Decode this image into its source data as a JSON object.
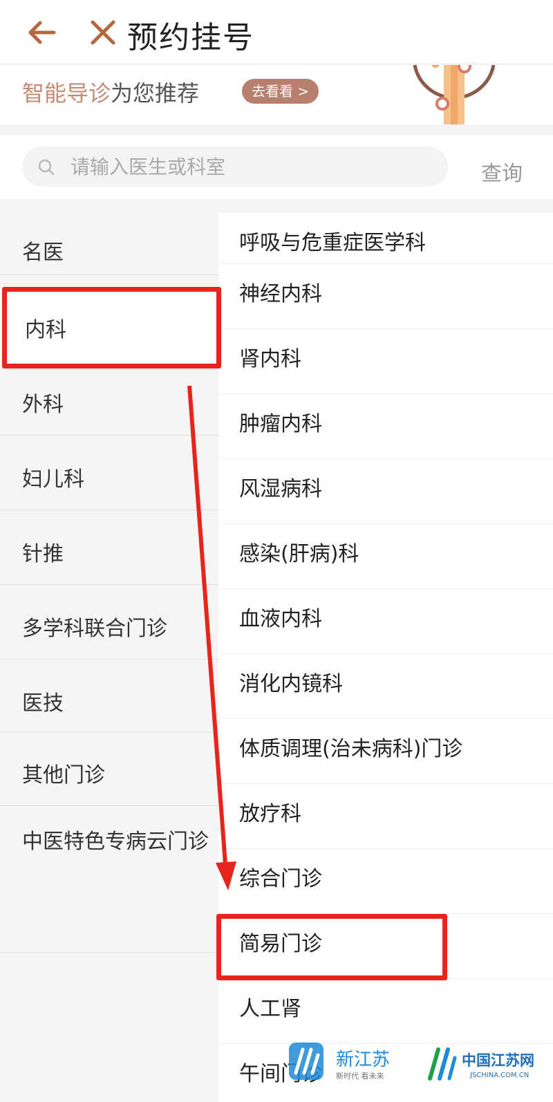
{
  "header": {
    "title": "预约挂号",
    "back_icon": "arrow-left-icon",
    "close_icon": "close-x-icon",
    "icon_color": "#b5683f"
  },
  "banner": {
    "highlight": "智能导诊",
    "text": "为您推荐",
    "button_label": "去看看 >"
  },
  "search": {
    "placeholder": "请输入医生或科室",
    "value": "",
    "button_label": "查询"
  },
  "left_nav": {
    "selected": "内科",
    "items": [
      {
        "label": "名医"
      },
      {
        "label": "内科"
      },
      {
        "label": "外科"
      },
      {
        "label": "妇儿科"
      },
      {
        "label": "针推"
      },
      {
        "label": "多学科联合门诊"
      },
      {
        "label": "医技"
      },
      {
        "label": "其他门诊"
      },
      {
        "label": "中医特色专病云门诊"
      }
    ]
  },
  "right_list": {
    "highlighted": "简易门诊",
    "items": [
      {
        "label": "呼吸与危重症医学科"
      },
      {
        "label": "神经内科"
      },
      {
        "label": "肾内科"
      },
      {
        "label": "肿瘤内科"
      },
      {
        "label": "风湿病科"
      },
      {
        "label": "感染(肝病)科"
      },
      {
        "label": "血液内科"
      },
      {
        "label": "消化内镜科"
      },
      {
        "label": "体质调理(治未病科)门诊"
      },
      {
        "label": "放疗科"
      },
      {
        "label": "综合门诊"
      },
      {
        "label": "简易门诊"
      },
      {
        "label": "人工肾"
      },
      {
        "label": "午间门诊"
      }
    ]
  },
  "annotation": {
    "color": "#e8251c"
  },
  "watermarks": [
    {
      "name": "新江苏",
      "tagline": "新时代 看未来"
    },
    {
      "name": "中国江苏网",
      "url": "JSCHINA.COM.CN"
    }
  ]
}
